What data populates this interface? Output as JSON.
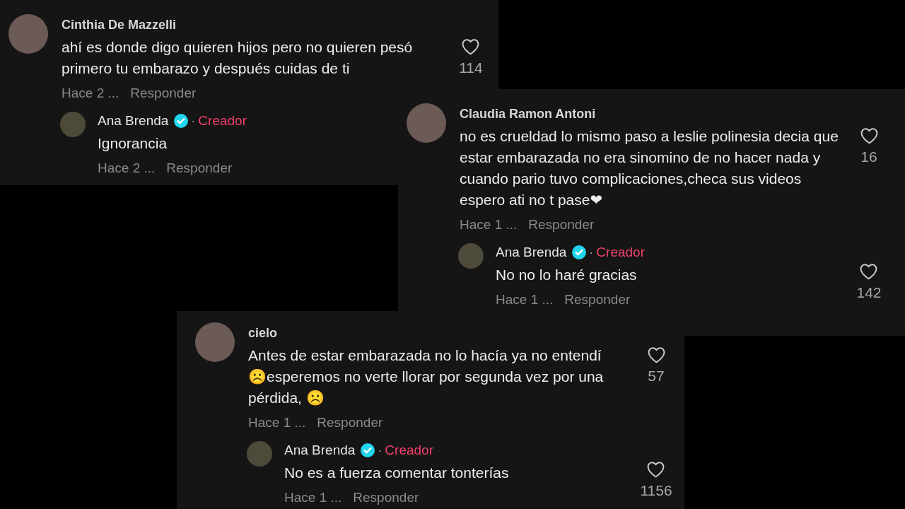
{
  "panels": [
    {
      "entries": [
        {
          "kind": "comment",
          "author": "Cinthia De Mazzelli",
          "text": "ahí es donde digo quieren hijos pero no quieren pesó primero tu embarazo y después cuidas de ti",
          "time": "Hace 2 ...",
          "reply_label": "Responder",
          "likes": "114"
        },
        {
          "kind": "reply",
          "author": "Ana Brenda",
          "verified": true,
          "separator": "·",
          "badge": "Creador",
          "text": "Ignorancia",
          "time": "Hace 2 ...",
          "reply_label": "Responder"
        }
      ]
    },
    {
      "entries": [
        {
          "kind": "comment",
          "author": "Claudia Ramon Antoni",
          "text": "no es crueldad lo mismo paso a leslie polinesia decia que estar embarazada no era sinomino de no hacer nada y cuando pario tuvo complicaciones,checa sus videos espero ati no t pase❤",
          "time": "Hace 1 ...",
          "reply_label": "Responder",
          "likes": "16"
        },
        {
          "kind": "reply",
          "author": "Ana Brenda",
          "verified": true,
          "separator": "·",
          "badge": "Creador",
          "text": "No no lo haré gracias",
          "time": "Hace 1 ...",
          "reply_label": "Responder",
          "likes": "142"
        }
      ]
    },
    {
      "entries": [
        {
          "kind": "comment",
          "author": "cielo",
          "text": "Antes de estar embarazada no lo hacía ya no entendí ☹️esperemos no verte llorar por segunda vez por una pérdida, ☹️",
          "time": "Hace 1 ...",
          "reply_label": "Responder",
          "likes": "57"
        },
        {
          "kind": "reply",
          "author": "Ana Brenda",
          "verified": true,
          "separator": "·",
          "badge": "Creador",
          "text": "No es a fuerza comentar tonterías",
          "time": "Hace 1 ...",
          "reply_label": "Responder",
          "likes": "1156"
        }
      ]
    }
  ]
}
